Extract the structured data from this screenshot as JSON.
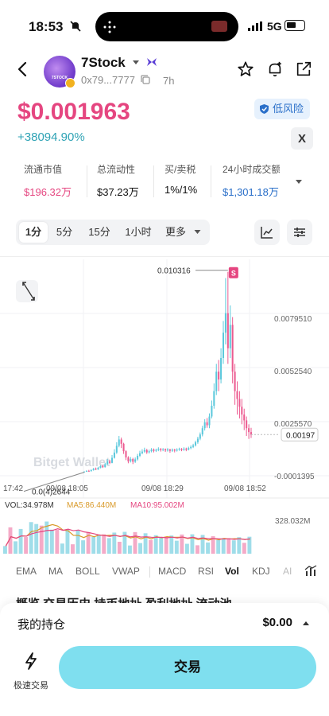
{
  "status": {
    "time": "18:53",
    "network": "5G"
  },
  "token": {
    "name": "7Stock",
    "address": "0x79...7777",
    "age": "7h",
    "avatar_text": "7STOCK",
    "price": "$0.001963",
    "change": "+38094.90%",
    "risk_label": "低风险",
    "x_label": "X"
  },
  "stats": [
    {
      "label": "流通市值",
      "value": "$196.32万",
      "color": "pink"
    },
    {
      "label": "总流动性",
      "value": "$37.23万",
      "color": "dark"
    },
    {
      "label": "买/卖税",
      "value": "1%/1%",
      "color": "dark"
    },
    {
      "label": "24小时成交额",
      "value": "$1,301.18万",
      "color": "blue"
    }
  ],
  "timeframes": [
    "1分",
    "5分",
    "15分",
    "1小时",
    "更多"
  ],
  "timeframe_selected": "1分",
  "chart_data": {
    "type": "candlestick",
    "y_ticks": [
      "0.0079510",
      "0.0052540",
      "0.0025570",
      "-0.0001395"
    ],
    "ylim": [
      -0.0001395,
      0.0099
    ],
    "x_ticks": [
      "17:42",
      "09/08 18:05",
      "09/08 18:29",
      "09/08 18:52"
    ],
    "high_label": "0.010316",
    "low_label": "0.0(4)2644",
    "last_price": "0.00197",
    "marker_label": "S",
    "watermark": "Bitget Wallet",
    "colors": {
      "up": "#5bc8dc",
      "down": "#ec5a90"
    },
    "candles": [
      [
        5e-05,
        7e-05,
        9e-05,
        4e-05
      ],
      [
        7e-05,
        0.00011,
        0.00014,
        6e-05
      ],
      [
        0.00011,
        9e-05,
        0.00016,
        8e-05
      ],
      [
        9e-05,
        0.00015,
        0.00019,
        8e-05
      ],
      [
        0.00015,
        0.00022,
        0.00026,
        0.00012
      ],
      [
        0.00022,
        0.00018,
        0.00028,
        0.00015
      ],
      [
        0.00018,
        0.00027,
        0.00032,
        0.00016
      ],
      [
        0.00027,
        0.00035,
        0.00041,
        0.00024
      ],
      [
        0.00035,
        0.0003,
        0.00043,
        0.00026
      ],
      [
        0.0003,
        0.00045,
        0.00052,
        0.00028
      ],
      [
        0.00045,
        0.0006,
        0.00072,
        0.00042
      ],
      [
        0.0006,
        0.00052,
        0.00068,
        0.00046
      ],
      [
        0.00052,
        0.00078,
        0.00092,
        0.0005
      ],
      [
        0.00078,
        0.00105,
        0.00122,
        0.00074
      ],
      [
        0.00105,
        0.0014,
        0.00158,
        0.00098
      ],
      [
        0.0014,
        0.00172,
        0.0019,
        0.00132
      ],
      [
        0.00172,
        0.0015,
        0.00182,
        0.00128
      ],
      [
        0.0015,
        0.00112,
        0.00155,
        0.00098
      ],
      [
        0.00112,
        0.0008,
        0.00116,
        0.00066
      ],
      [
        0.0008,
        0.0006,
        0.00086,
        0.0005
      ],
      [
        0.0006,
        0.00072,
        0.00082,
        0.00054
      ],
      [
        0.00072,
        0.00058,
        0.00078,
        0.00046
      ],
      [
        0.00058,
        0.0007,
        0.0008,
        0.00052
      ],
      [
        0.0007,
        0.00088,
        0.00098,
        0.00064
      ],
      [
        0.00088,
        0.00102,
        0.00114,
        0.00082
      ],
      [
        0.00102,
        0.0011,
        0.00122,
        0.00096
      ],
      [
        0.0011,
        0.00118,
        0.0013,
        0.00104
      ],
      [
        0.00118,
        0.00106,
        0.00124,
        0.00098
      ],
      [
        0.00106,
        0.00112,
        0.0012,
        0.001
      ],
      [
        0.00112,
        0.0012,
        0.00128,
        0.00106
      ],
      [
        0.0012,
        0.00114,
        0.00126,
        0.00106
      ],
      [
        0.00114,
        0.00119,
        0.00125,
        0.00108
      ],
      [
        0.00119,
        0.00124,
        0.00132,
        0.00112
      ],
      [
        0.00124,
        0.00118,
        0.00128,
        0.0011
      ],
      [
        0.00118,
        0.00122,
        0.00128,
        0.00112
      ],
      [
        0.00122,
        0.00116,
        0.00126,
        0.00108
      ],
      [
        0.00116,
        0.00121,
        0.00128,
        0.0011
      ],
      [
        0.00121,
        0.00114,
        0.00124,
        0.00104
      ],
      [
        0.00114,
        0.0012,
        0.00126,
        0.00108
      ],
      [
        0.0012,
        0.00115,
        0.00124,
        0.00106
      ],
      [
        0.00115,
        0.0012,
        0.00127,
        0.0011
      ],
      [
        0.0012,
        0.00124,
        0.0013,
        0.00114
      ],
      [
        0.00124,
        0.00119,
        0.00128,
        0.00112
      ],
      [
        0.00119,
        0.00125,
        0.00132,
        0.00114
      ],
      [
        0.00125,
        0.0012,
        0.0013,
        0.00112
      ],
      [
        0.0012,
        0.00128,
        0.00135,
        0.00116
      ],
      [
        0.00128,
        0.00134,
        0.00142,
        0.00122
      ],
      [
        0.00134,
        0.00142,
        0.0015,
        0.00128
      ],
      [
        0.00142,
        0.00158,
        0.00166,
        0.00136
      ],
      [
        0.00158,
        0.00176,
        0.00186,
        0.0015
      ],
      [
        0.00176,
        0.00198,
        0.00208,
        0.00168
      ],
      [
        0.00198,
        0.0023,
        0.00242,
        0.00188
      ],
      [
        0.0023,
        0.0026,
        0.00276,
        0.00218
      ],
      [
        0.0026,
        0.00245,
        0.00282,
        0.00232
      ],
      [
        0.00245,
        0.0029,
        0.00306,
        0.0023
      ],
      [
        0.0029,
        0.00345,
        0.00372,
        0.0028
      ],
      [
        0.00345,
        0.0042,
        0.0046,
        0.0033
      ],
      [
        0.0042,
        0.0052,
        0.0056,
        0.004
      ],
      [
        0.0052,
        0.0048,
        0.0058,
        0.0042
      ],
      [
        0.0048,
        0.0059,
        0.0064,
        0.0046
      ],
      [
        0.0059,
        0.0072,
        0.0078,
        0.0056
      ],
      [
        0.0072,
        0.0082,
        0.01,
        0.0066
      ],
      [
        0.0082,
        0.0064,
        0.01032,
        0.0056
      ],
      [
        0.0064,
        0.0076,
        0.0086,
        0.0059
      ],
      [
        0.0076,
        0.0052,
        0.008,
        0.0046
      ],
      [
        0.0052,
        0.0042,
        0.0056,
        0.0035
      ],
      [
        0.0042,
        0.0038,
        0.0047,
        0.003
      ],
      [
        0.0038,
        0.0034,
        0.0042,
        0.0028
      ],
      [
        0.0034,
        0.003,
        0.0038,
        0.0025
      ],
      [
        0.003,
        0.0027,
        0.0033,
        0.0022
      ],
      [
        0.0027,
        0.0023,
        0.0029,
        0.0019
      ],
      [
        0.0023,
        0.0021,
        0.0025,
        0.00175
      ],
      [
        0.0021,
        0.00197,
        0.00232,
        0.0018
      ]
    ],
    "volume_ticks": [
      "328.032M"
    ]
  },
  "volume_legend": {
    "vol": "VOL:34.978M",
    "ma5": "MA5:86.440M",
    "ma10": "MA10:95.002M"
  },
  "indicator_tabs": [
    "EMA",
    "MA",
    "BOLL",
    "VWAP",
    "MACD",
    "RSI",
    "Vol",
    "KDJ",
    "AI"
  ],
  "indicator_selected": "Vol",
  "cut_text": "概览    交易历史    持币地址    盈利地址    流动池",
  "bottom": {
    "holding_label": "我的持仓",
    "holding_value": "$0.00",
    "quick_label": "极速交易",
    "trade_label": "交易"
  }
}
